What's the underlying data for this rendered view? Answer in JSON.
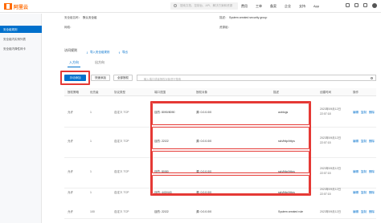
{
  "header": {
    "logo_text": "阿里云",
    "search_placeholder": "搜索文档、控制台、API、解决方案和资源",
    "nav": [
      "费用",
      "工单",
      "备案",
      "企业",
      "支持",
      "App"
    ]
  },
  "sidebar": {
    "items": [
      {
        "label": "安全组规则",
        "active": true
      },
      {
        "label": "安全组内实例列表",
        "active": false
      },
      {
        "label": "安全组内弹性网卡",
        "active": false
      }
    ]
  },
  "info": {
    "desc_label": "安全组名称：",
    "desc_value": "默认安全组",
    "vpc_label": "描述：",
    "vpc_value": "System created security group",
    "net_label": "网络：",
    "net_value": "",
    "type_label": "资源组：",
    "type_value": ""
  },
  "section": {
    "title": "访问规则",
    "link_import": "导入安全组规则",
    "link_export": "导出"
  },
  "tabs": [
    "入方向",
    "出方向"
  ],
  "actions": {
    "manual_add": "手动添加",
    "quick_add": "快速添加",
    "all_auth": "全部授权",
    "filter_placeholder": "输入端口或者授权对象进行搜索"
  },
  "table": {
    "headers": [
      "授权策略",
      "优先级",
      "协议类型",
      "端口范围",
      "授权对象",
      "描述",
      "创建时间",
      "操作"
    ],
    "rows": [
      {
        "policy": "允许",
        "priority": "1",
        "protocol": "自定义 TCP",
        "port": "目的: 8090/8090",
        "source": "源: 0.0.0.0/0",
        "desc": "aoblogs",
        "time": "2023年09月12日 22:07:18",
        "ops": [
          "编辑",
          "复制",
          "删除"
        ]
      },
      {
        "policy": "允许",
        "priority": "1",
        "protocol": "自定义 TCP",
        "port": "目的: 22/22",
        "source": "源: 0.0.0.0/0",
        "desc": "ssh/http/https",
        "time": "2023年09月12日 22:07:15",
        "ops": [
          "编辑",
          "复制",
          "删除"
        ]
      },
      {
        "policy": "允许",
        "priority": "1",
        "protocol": "自定义 TCP",
        "port": "目的: 80/80",
        "source": "源: 0.0.0.0/0",
        "desc": "ssh/http/https",
        "time": "2023年09月12日 22:07:15",
        "ops": [
          "编辑",
          "复制",
          "删除"
        ]
      },
      {
        "policy": "允许",
        "priority": "1",
        "protocol": "自定义 TCP",
        "port": "目的: 443/443",
        "source": "源: 0.0.0.0/0",
        "desc": "ssh/http/https",
        "time": "2023年09月12日 22:07:15",
        "ops": [
          "编辑",
          "复制",
          "删除"
        ]
      },
      {
        "policy": "允许",
        "priority": "100",
        "protocol": "自定义 TCP",
        "port": "目的: 22/22",
        "source": "源: 0.0.0.0/0",
        "desc": "System created rule",
        "time": "2023年09月12日",
        "ops": [
          "编辑",
          "复制",
          "删除"
        ]
      }
    ]
  },
  "colors": {
    "accent": "#0070cc",
    "brand": "#ff6a00",
    "highlight": "#e53935"
  }
}
